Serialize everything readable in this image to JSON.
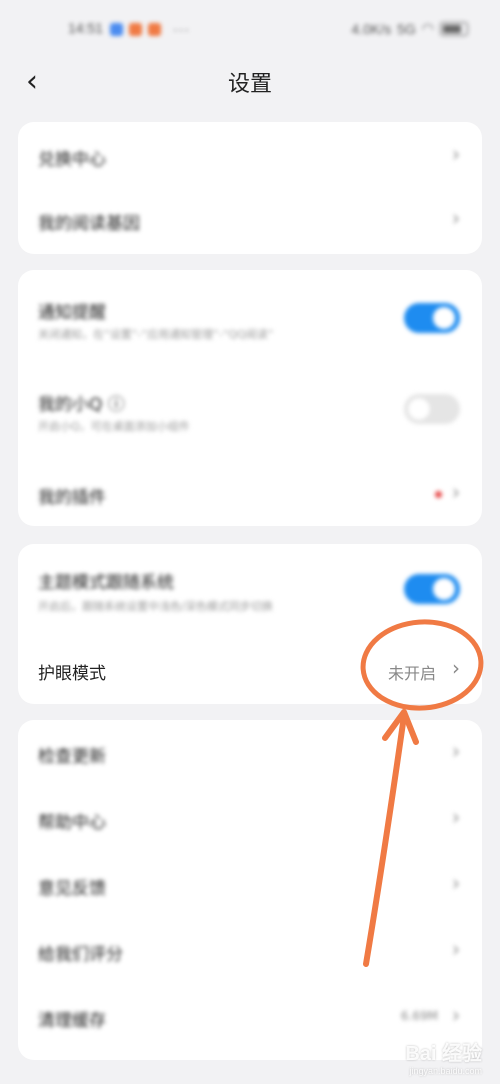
{
  "status_bar": {
    "time": "14:51",
    "speed": "4.0K/s",
    "signal": "5G",
    "more": "···"
  },
  "header": {
    "back_icon": "‹",
    "title": "设置"
  },
  "card1": {
    "items": [
      {
        "label": "兑换中心"
      },
      {
        "label": "我的阅读基因"
      }
    ]
  },
  "card2": {
    "notify": {
      "label": "通知提醒",
      "sub": "关闭通知，在“设置”-“应用通知管理”-“QQ阅读”",
      "enabled": true
    },
    "xiaoq": {
      "label": "我的小Q ⓘ",
      "sub": "开启小Q，可在桌面添加小组件",
      "enabled": false
    },
    "plugins": {
      "label": "我的插件"
    }
  },
  "card3": {
    "theme": {
      "label": "主题模式跟随系统",
      "sub": "开启后，跟随系统设置中浅色/深色模式同步切换",
      "enabled": true
    },
    "eye": {
      "label": "护眼模式",
      "value": "未开启"
    }
  },
  "card4": {
    "items": [
      {
        "label": "检查更新"
      },
      {
        "label": "帮助中心"
      },
      {
        "label": "意见反馈"
      },
      {
        "label": "给我们评分"
      },
      {
        "label": "清理缓存",
        "value": "6.69M"
      }
    ]
  },
  "chevron": "›",
  "colors": {
    "toggle_on": "#1e8cf0",
    "annotation": "#f07a44",
    "badge": "#e64545"
  },
  "watermark": {
    "brand": "Bai 经验",
    "url": "jingyan.baidu.com"
  }
}
